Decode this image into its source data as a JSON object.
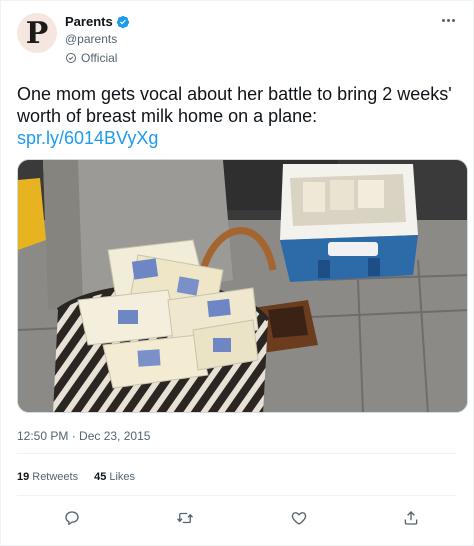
{
  "account": {
    "name": "Parents",
    "handle": "@parents",
    "label": "Official",
    "avatar_letter": "P"
  },
  "tweet": {
    "text": "One mom gets vocal about her battle to bring 2 weeks' worth of breast milk home on a plane:",
    "link": "spr.ly/6014BVyXg",
    "timestamp": "12:50 PM · Dec 23, 2015"
  },
  "stats": {
    "retweets_count": "19",
    "retweets_label": "Retweets",
    "likes_count": "45",
    "likes_label": "Likes"
  },
  "actions": {
    "reply_icon": "reply-icon",
    "retweet_icon": "retweet-icon",
    "like_icon": "heart-icon",
    "share_icon": "share-icon"
  },
  "colors": {
    "link": "#1d9bf0",
    "verified": "#1d9bf0",
    "secondary_text": "#536471"
  }
}
